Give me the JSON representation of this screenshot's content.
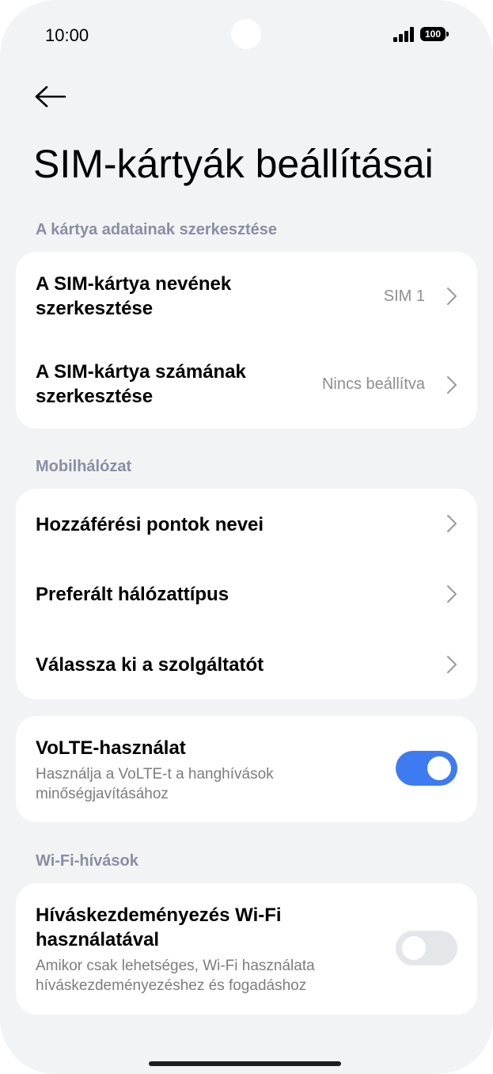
{
  "status": {
    "time": "10:00",
    "battery": "100",
    "signal_icon": "signal-icon"
  },
  "header": {
    "back_icon": "arrow-left-icon",
    "title": "SIM-kártyák beállításai"
  },
  "sections": {
    "card_data": "A kártya adatainak szerkesztése",
    "mobile": "Mobilhálózat",
    "wifi": "Wi-Fi-hívások"
  },
  "card_edit": {
    "sim_name": {
      "label": "A SIM-kártya nevének szerkesztése",
      "value": "SIM 1"
    },
    "sim_number": {
      "label": "A SIM-kártya számának szerkesztése",
      "value": "Nincs beállítva"
    }
  },
  "mobile_network": {
    "apn": "Hozzáférési pontok nevei",
    "network_type": "Preferált hálózattípus",
    "operator": "Válassza ki a szolgáltatót"
  },
  "volte": {
    "label": "VoLTE-használat",
    "desc": "Használja a VoLTE-t a hanghívások minőségjavításához",
    "enabled": true,
    "accent": "#3e7bf0"
  },
  "wifi_calling": {
    "label": "Híváskezdeményezés Wi-Fi használatával",
    "desc": "Amikor csak lehetséges, Wi-Fi használata híváskezdeményezéshez és fogadáshoz",
    "enabled": false
  }
}
